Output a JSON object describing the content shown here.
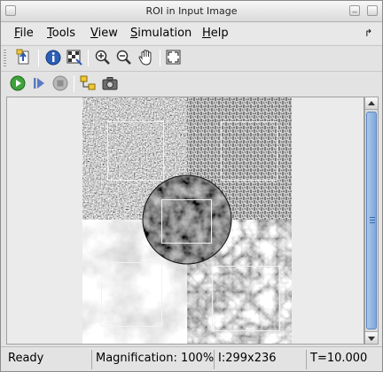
{
  "window": {
    "title": "ROI in Input Image"
  },
  "menubar": {
    "items": [
      {
        "mnemonic": "F",
        "rest": "ile"
      },
      {
        "mnemonic": "T",
        "rest": "ools"
      },
      {
        "mnemonic": "V",
        "rest": "iew"
      },
      {
        "mnemonic": "S",
        "rest": "imulation"
      },
      {
        "mnemonic": "H",
        "rest": "elp"
      }
    ]
  },
  "toolbar": {
    "buttons": [
      "export-icon",
      "info-icon",
      "pixel-region-icon",
      "zoom-in-icon",
      "zoom-out-icon",
      "pan-icon",
      "fit-to-window-icon"
    ]
  },
  "simulation_toolbar": {
    "buttons": [
      "start-icon",
      "step-icon",
      "stop-icon",
      "highlight-model-icon",
      "snapshot-icon"
    ]
  },
  "statusbar": {
    "status": "Ready",
    "magnification": "Magnification: 100%",
    "image_info": "I:299x236",
    "time": "T=10.000"
  },
  "colors": {
    "roi_outline": "#f2f2f2",
    "scroll_thumb": "#8fb3e3"
  }
}
